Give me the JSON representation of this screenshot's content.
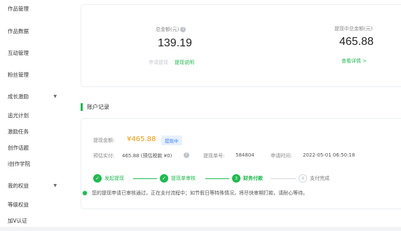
{
  "sidebar": {
    "items": [
      {
        "label": "作品管理"
      },
      {
        "label": "作品数据"
      },
      {
        "label": "互动管理"
      },
      {
        "label": "粉丝管理"
      },
      {
        "label": "成长激励"
      },
      {
        "label": "追光计划"
      },
      {
        "label": "激励任务"
      },
      {
        "label": "创作话题"
      },
      {
        "label": "i创作学院"
      },
      {
        "label": "我的权益"
      },
      {
        "label": "等级权益"
      },
      {
        "label": "加V认证"
      }
    ]
  },
  "summary": {
    "total_label": "总金额(元)",
    "total_value": "139.19",
    "apply_withdraw": "申请提现",
    "withdraw_note": "提现说明",
    "pending_label": "提现中总金额(元)",
    "pending_value": "465.88",
    "view_details": "查看详情 >"
  },
  "records": {
    "section_title": "账户记录",
    "amount_label": "提现金额:",
    "amount_value": "¥465.88",
    "status_badge": "提现中",
    "actual_label": "预估实付:",
    "actual_value": "465.88 (预估税款 ¥0)",
    "order_label": "提现单号:",
    "order_value": "584804",
    "time_label": "申请时间:",
    "time_value": "2022-05-01 06:50:18",
    "steps": [
      {
        "label": "发起提现",
        "state": "done",
        "mark": "✓"
      },
      {
        "label": "提现单审核",
        "state": "done",
        "mark": "✓"
      },
      {
        "label": "财务付款",
        "state": "current",
        "mark": "3"
      },
      {
        "label": "支付完成",
        "state": "pending",
        "mark": "4"
      }
    ],
    "notice": "您的提现申请已审核通过，正在支付流程中；如节假日等特殊情况，将尽快审期打款，请耐心等待。"
  },
  "colors": {
    "accent_green": "#20b94f",
    "amount_orange": "#f29a0f",
    "badge_blue": "#3b82f6"
  }
}
